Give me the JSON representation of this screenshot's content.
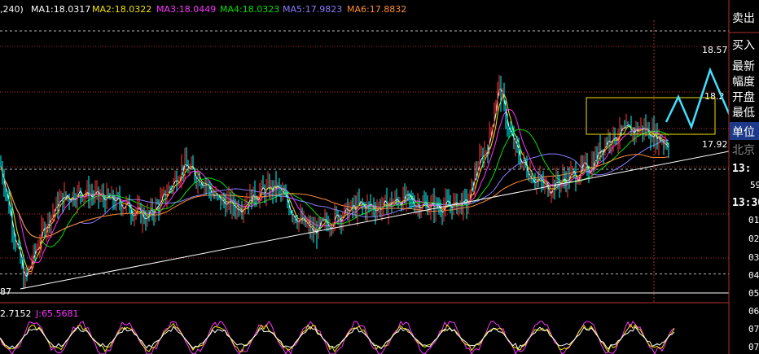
{
  "header": {
    "prefix": ",240)",
    "ma": [
      {
        "label": "MA1:18.0317",
        "color": "#ffffff"
      },
      {
        "label": "MA2:18.0322",
        "color": "#f2e200"
      },
      {
        "label": "MA3:18.0449",
        "color": "#ff33ff"
      },
      {
        "label": "MA4:18.0323",
        "color": "#00e000"
      },
      {
        "label": "MA5:17.9823",
        "color": "#8a7cff"
      },
      {
        "label": "MA6:17.8832",
        "color": "#ff8c32"
      }
    ]
  },
  "indicator_header": {
    "k_value": "2.7152",
    "j_value": "J:65.5681",
    "j_color": "#ff33ff"
  },
  "price_labels": {
    "top": "18.57",
    "box": "18.2",
    "bottom": "17.92",
    "low": "87"
  },
  "side_panel": {
    "items": [
      "卖出",
      "买入",
      "最新",
      "幅度",
      "开盘",
      "最低",
      "单位",
      "北京"
    ],
    "times": [
      "13:",
      "59",
      "13:30",
      "01",
      "02",
      "03",
      "04",
      "05",
      "06",
      "07",
      "07"
    ]
  },
  "chart_data": {
    "type": "candlestick",
    "ylim": [
      17.88,
      18.62
    ],
    "reference_levels": [
      18.57,
      18.2,
      17.92
    ],
    "current_price": 18.03,
    "indicator_lines": [
      "K",
      "J"
    ],
    "colors": {
      "up": "#ff3b3b",
      "down": "#00ffff",
      "grid": "#b0302a"
    }
  }
}
